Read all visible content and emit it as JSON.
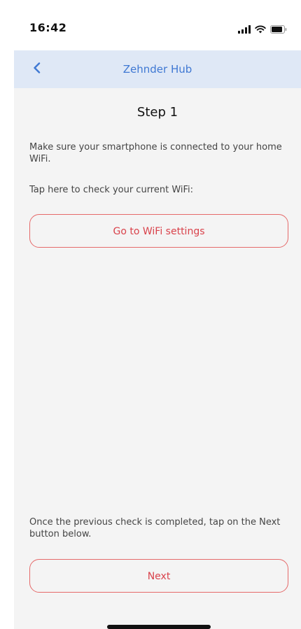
{
  "status_bar": {
    "time": "16:42",
    "icons": [
      "cellular-signal-icon",
      "wifi-icon",
      "battery-icon"
    ]
  },
  "nav_bar": {
    "back_icon": "chevron-left-icon",
    "title": "Zehnder Hub"
  },
  "content": {
    "step_title": "Step 1",
    "instruction_1": "Make sure your smartphone is connected to your home WiFi.",
    "instruction_2": "Tap here to check your current WiFi:",
    "wifi_button_label": "Go to WiFi settings",
    "instruction_3": "Once the previous check is completed, tap on the Next button below.",
    "next_button_label": "Next"
  },
  "colors": {
    "nav_background": "#dfe8f6",
    "accent_blue": "#3f78d3",
    "button_red": "#d9424b",
    "content_background": "#f4f4f4"
  }
}
